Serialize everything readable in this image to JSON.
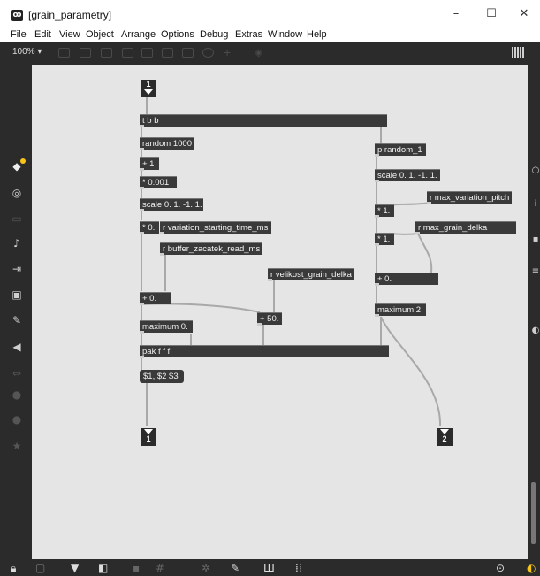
{
  "window": {
    "title": "[grain_parametry]",
    "app_icon": "max-icon",
    "minimize": "–",
    "maximize": "☐",
    "close": "✕"
  },
  "menu": [
    "File",
    "Edit",
    "View",
    "Object",
    "Arrange",
    "Options",
    "Debug",
    "Extras",
    "Window",
    "Help"
  ],
  "toolbar": {
    "zoom": "100% ▾"
  },
  "inlets": {
    "in1": "1"
  },
  "outlets": {
    "out1": "1",
    "out2": "2"
  },
  "objects": {
    "tbb": "t b b",
    "random": "random 1000",
    "plus1": "+ 1",
    "mult001": "* 0.001",
    "scale_left": "scale 0. 1. -1. 1.",
    "r_variation": "r variation_starting_time_ms",
    "mult0": "* 0.",
    "r_buffer": "r buffer_zacatek_read_ms",
    "r_velikost": "r velikost_grain_delka",
    "plus0_left": "+ 0.",
    "plus50": "+ 50.",
    "maximum0": "maximum 0.",
    "pakfff": "pak f f f",
    "p_random": "p random_1",
    "scale_right": "scale 0. 1. -1. 1.",
    "r_max_variation": "r max_variation_pitch",
    "mult1a": "* 1.",
    "r_max_grain": "r max_grain_delka",
    "mult1b": "* 1.",
    "plus0_right": "+ 0.",
    "maximum2": "maximum 2."
  },
  "message": {
    "msg1": "$1, $2 $3"
  },
  "colors": {
    "canvas": "#e5e5e5",
    "object": "#3a3a3a",
    "chrome": "#2b2b2b",
    "cord": "#a9a9a9"
  }
}
